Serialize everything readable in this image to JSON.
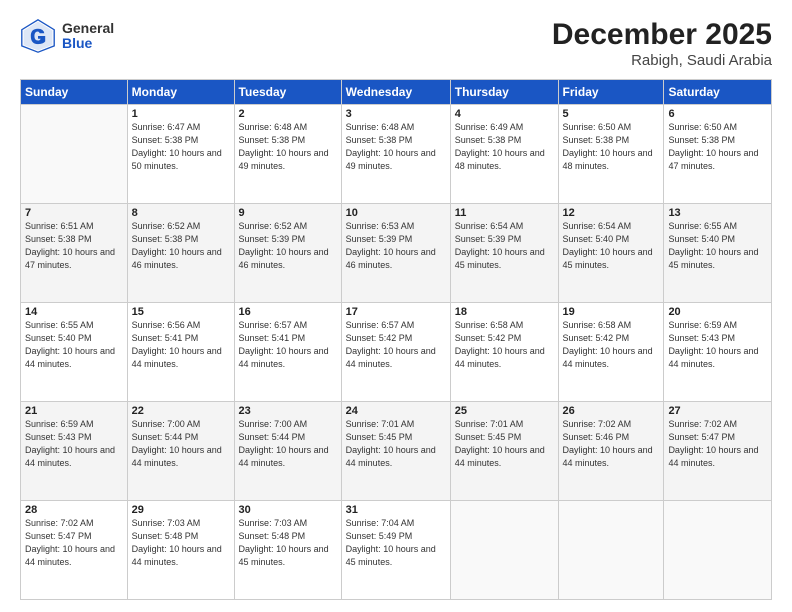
{
  "header": {
    "logo_general": "General",
    "logo_blue": "Blue",
    "title": "December 2025",
    "subtitle": "Rabigh, Saudi Arabia"
  },
  "weekdays": [
    "Sunday",
    "Monday",
    "Tuesday",
    "Wednesday",
    "Thursday",
    "Friday",
    "Saturday"
  ],
  "weeks": [
    [
      {
        "day": "",
        "sunrise": "",
        "sunset": "",
        "daylight": ""
      },
      {
        "day": "1",
        "sunrise": "Sunrise: 6:47 AM",
        "sunset": "Sunset: 5:38 PM",
        "daylight": "Daylight: 10 hours and 50 minutes."
      },
      {
        "day": "2",
        "sunrise": "Sunrise: 6:48 AM",
        "sunset": "Sunset: 5:38 PM",
        "daylight": "Daylight: 10 hours and 49 minutes."
      },
      {
        "day": "3",
        "sunrise": "Sunrise: 6:48 AM",
        "sunset": "Sunset: 5:38 PM",
        "daylight": "Daylight: 10 hours and 49 minutes."
      },
      {
        "day": "4",
        "sunrise": "Sunrise: 6:49 AM",
        "sunset": "Sunset: 5:38 PM",
        "daylight": "Daylight: 10 hours and 48 minutes."
      },
      {
        "day": "5",
        "sunrise": "Sunrise: 6:50 AM",
        "sunset": "Sunset: 5:38 PM",
        "daylight": "Daylight: 10 hours and 48 minutes."
      },
      {
        "day": "6",
        "sunrise": "Sunrise: 6:50 AM",
        "sunset": "Sunset: 5:38 PM",
        "daylight": "Daylight: 10 hours and 47 minutes."
      }
    ],
    [
      {
        "day": "7",
        "sunrise": "Sunrise: 6:51 AM",
        "sunset": "Sunset: 5:38 PM",
        "daylight": "Daylight: 10 hours and 47 minutes."
      },
      {
        "day": "8",
        "sunrise": "Sunrise: 6:52 AM",
        "sunset": "Sunset: 5:38 PM",
        "daylight": "Daylight: 10 hours and 46 minutes."
      },
      {
        "day": "9",
        "sunrise": "Sunrise: 6:52 AM",
        "sunset": "Sunset: 5:39 PM",
        "daylight": "Daylight: 10 hours and 46 minutes."
      },
      {
        "day": "10",
        "sunrise": "Sunrise: 6:53 AM",
        "sunset": "Sunset: 5:39 PM",
        "daylight": "Daylight: 10 hours and 46 minutes."
      },
      {
        "day": "11",
        "sunrise": "Sunrise: 6:54 AM",
        "sunset": "Sunset: 5:39 PM",
        "daylight": "Daylight: 10 hours and 45 minutes."
      },
      {
        "day": "12",
        "sunrise": "Sunrise: 6:54 AM",
        "sunset": "Sunset: 5:40 PM",
        "daylight": "Daylight: 10 hours and 45 minutes."
      },
      {
        "day": "13",
        "sunrise": "Sunrise: 6:55 AM",
        "sunset": "Sunset: 5:40 PM",
        "daylight": "Daylight: 10 hours and 45 minutes."
      }
    ],
    [
      {
        "day": "14",
        "sunrise": "Sunrise: 6:55 AM",
        "sunset": "Sunset: 5:40 PM",
        "daylight": "Daylight: 10 hours and 44 minutes."
      },
      {
        "day": "15",
        "sunrise": "Sunrise: 6:56 AM",
        "sunset": "Sunset: 5:41 PM",
        "daylight": "Daylight: 10 hours and 44 minutes."
      },
      {
        "day": "16",
        "sunrise": "Sunrise: 6:57 AM",
        "sunset": "Sunset: 5:41 PM",
        "daylight": "Daylight: 10 hours and 44 minutes."
      },
      {
        "day": "17",
        "sunrise": "Sunrise: 6:57 AM",
        "sunset": "Sunset: 5:42 PM",
        "daylight": "Daylight: 10 hours and 44 minutes."
      },
      {
        "day": "18",
        "sunrise": "Sunrise: 6:58 AM",
        "sunset": "Sunset: 5:42 PM",
        "daylight": "Daylight: 10 hours and 44 minutes."
      },
      {
        "day": "19",
        "sunrise": "Sunrise: 6:58 AM",
        "sunset": "Sunset: 5:42 PM",
        "daylight": "Daylight: 10 hours and 44 minutes."
      },
      {
        "day": "20",
        "sunrise": "Sunrise: 6:59 AM",
        "sunset": "Sunset: 5:43 PM",
        "daylight": "Daylight: 10 hours and 44 minutes."
      }
    ],
    [
      {
        "day": "21",
        "sunrise": "Sunrise: 6:59 AM",
        "sunset": "Sunset: 5:43 PM",
        "daylight": "Daylight: 10 hours and 44 minutes."
      },
      {
        "day": "22",
        "sunrise": "Sunrise: 7:00 AM",
        "sunset": "Sunset: 5:44 PM",
        "daylight": "Daylight: 10 hours and 44 minutes."
      },
      {
        "day": "23",
        "sunrise": "Sunrise: 7:00 AM",
        "sunset": "Sunset: 5:44 PM",
        "daylight": "Daylight: 10 hours and 44 minutes."
      },
      {
        "day": "24",
        "sunrise": "Sunrise: 7:01 AM",
        "sunset": "Sunset: 5:45 PM",
        "daylight": "Daylight: 10 hours and 44 minutes."
      },
      {
        "day": "25",
        "sunrise": "Sunrise: 7:01 AM",
        "sunset": "Sunset: 5:45 PM",
        "daylight": "Daylight: 10 hours and 44 minutes."
      },
      {
        "day": "26",
        "sunrise": "Sunrise: 7:02 AM",
        "sunset": "Sunset: 5:46 PM",
        "daylight": "Daylight: 10 hours and 44 minutes."
      },
      {
        "day": "27",
        "sunrise": "Sunrise: 7:02 AM",
        "sunset": "Sunset: 5:47 PM",
        "daylight": "Daylight: 10 hours and 44 minutes."
      }
    ],
    [
      {
        "day": "28",
        "sunrise": "Sunrise: 7:02 AM",
        "sunset": "Sunset: 5:47 PM",
        "daylight": "Daylight: 10 hours and 44 minutes."
      },
      {
        "day": "29",
        "sunrise": "Sunrise: 7:03 AM",
        "sunset": "Sunset: 5:48 PM",
        "daylight": "Daylight: 10 hours and 44 minutes."
      },
      {
        "day": "30",
        "sunrise": "Sunrise: 7:03 AM",
        "sunset": "Sunset: 5:48 PM",
        "daylight": "Daylight: 10 hours and 45 minutes."
      },
      {
        "day": "31",
        "sunrise": "Sunrise: 7:04 AM",
        "sunset": "Sunset: 5:49 PM",
        "daylight": "Daylight: 10 hours and 45 minutes."
      },
      {
        "day": "",
        "sunrise": "",
        "sunset": "",
        "daylight": ""
      },
      {
        "day": "",
        "sunrise": "",
        "sunset": "",
        "daylight": ""
      },
      {
        "day": "",
        "sunrise": "",
        "sunset": "",
        "daylight": ""
      }
    ]
  ]
}
